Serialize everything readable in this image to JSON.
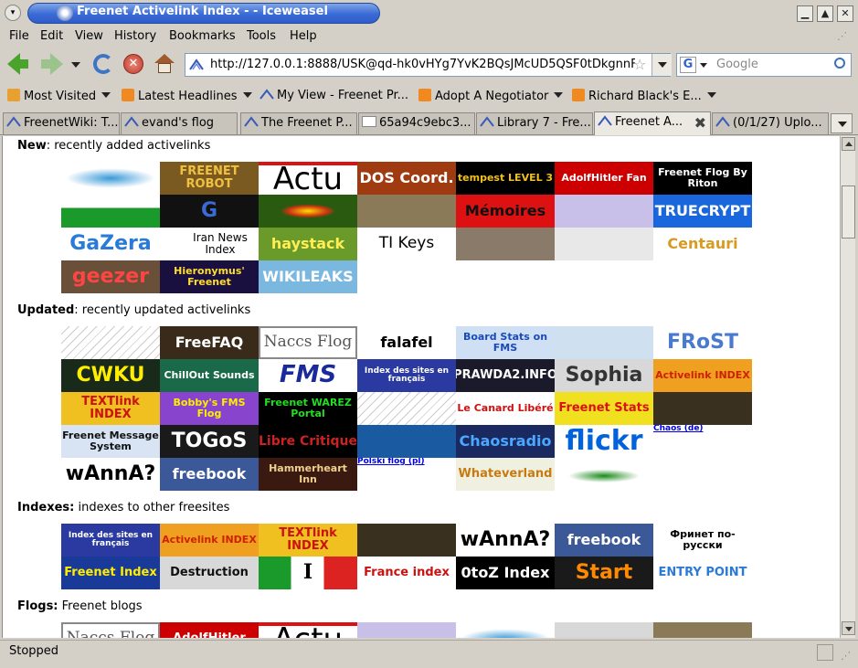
{
  "window": {
    "title": "Freenet Activelink Index - - Iceweasel",
    "buttons": [
      "minimize",
      "maximize",
      "close"
    ]
  },
  "menu": [
    "File",
    "Edit",
    "View",
    "History",
    "Bookmarks",
    "Tools",
    "Help"
  ],
  "nav": {
    "url": "http://127.0.0.1:8888/USK@qd-hk0vHYg7YvK2BQsJMcUD5QSF0tDkgnnF",
    "search_placeholder": "Google",
    "search_engine_letter": "G"
  },
  "bookmarks": [
    {
      "label": "Most Visited",
      "icon": "folder-icon",
      "dropdown": true
    },
    {
      "label": "Latest Headlines",
      "icon": "rss-icon",
      "dropdown": true
    },
    {
      "label": "My View - Freenet Pr...",
      "icon": "freenet-icon",
      "dropdown": false
    },
    {
      "label": "Adopt A Negotiator",
      "icon": "rss-icon",
      "dropdown": true
    },
    {
      "label": "Richard Black's E...",
      "icon": "rss-icon",
      "dropdown": true
    }
  ],
  "tabs": [
    {
      "label": "FreenetWiki: T...",
      "active": false
    },
    {
      "label": "evand's flog",
      "active": false
    },
    {
      "label": "The Freenet P...",
      "active": false
    },
    {
      "label": "65a94c9ebc3...",
      "active": false
    },
    {
      "label": "Library 7 - Fre...",
      "active": false
    },
    {
      "label": "Freenet A...",
      "active": true
    },
    {
      "label": "(0/1/27) Uplo...",
      "active": false
    }
  ],
  "sections": [
    {
      "heading": "New",
      "description": ": recently added activelinks",
      "tiles": [
        {
          "text": "",
          "bg": "#ffffff",
          "fg": "#2a8ac8",
          "kind": "blue-sneaker"
        },
        {
          "text": "FREENET ROBOT",
          "bg": "#7a5a20",
          "fg": "#f0c040"
        },
        {
          "text": "Actu",
          "bg": "#ffffff",
          "fg": "#000000",
          "kind": "actu"
        },
        {
          "text": "DOS Coord.",
          "bg": "#a03a10",
          "fg": "#ffffff"
        },
        {
          "text": "tempest LEVEL 3",
          "bg": "#000000",
          "fg": "#f0c020"
        },
        {
          "text": "AdolfHitler Fan",
          "bg": "#cc0000",
          "fg": "#ffffff"
        },
        {
          "text": "Freenet Flog By Riton",
          "bg": "#000000",
          "fg": "#ffffff"
        },
        {
          "text": "",
          "bg": "#1a9a2a",
          "fg": "#ffffff",
          "kind": "green-flag"
        },
        {
          "text": "G",
          "bg": "#111111",
          "fg": "#3a6ad6"
        },
        {
          "text": "",
          "bg": "#2a5a10",
          "fg": "#ffdd00",
          "kind": "eye"
        },
        {
          "text": "",
          "bg": "#8a7a58",
          "fg": "#ffffff"
        },
        {
          "text": "Mémoires",
          "bg": "#dd1111",
          "fg": "#111111"
        },
        {
          "text": "",
          "bg": "#c8c0e8",
          "fg": "#ffffff"
        },
        {
          "text": "TRUECRYPT",
          "bg": "#1a66dd",
          "fg": "#ffffff"
        },
        {
          "text": "GaZera",
          "bg": "#ffffff",
          "fg": "#2a7ad8"
        },
        {
          "text": "Iran News Index",
          "bg": "#ffffff",
          "fg": "#000000",
          "kind": "iran"
        },
        {
          "text": "haystack",
          "bg": "#6a9a2a",
          "fg": "#ffee55"
        },
        {
          "text": "TI Keys",
          "bg": "#ffffff",
          "fg": "#000000",
          "kind": "tikeys"
        },
        {
          "text": "",
          "bg": "#8a7a6a",
          "fg": "#ffffff"
        },
        {
          "text": "",
          "bg": "#e8e8e8",
          "fg": "#333333"
        },
        {
          "text": "Centauri",
          "bg": "#ffffff",
          "fg": "#d89a20"
        },
        {
          "text": "geezer",
          "bg": "#6a5038",
          "fg": "#ff4444"
        },
        {
          "text": "Hieronymus' Freenet",
          "bg": "#1a1040",
          "fg": "#ffdd33"
        },
        {
          "text": "WIKILEAKS",
          "bg": "#7ab8e0",
          "fg": "#ffffff"
        }
      ]
    },
    {
      "heading": "Updated",
      "description": ": recently updated activelinks",
      "tiles": [
        {
          "text": "",
          "bg": "#f0f0f0",
          "fg": "#000000",
          "kind": "manga"
        },
        {
          "text": "FreeFAQ",
          "bg": "#3a2a1a",
          "fg": "#ffffff"
        },
        {
          "text": "Naccs Flog",
          "bg": "#ffffff",
          "fg": "#555555",
          "kind": "naccs"
        },
        {
          "text": "falafel",
          "bg": "#ffffff",
          "fg": "#000000"
        },
        {
          "text": "Board Stats on FMS",
          "bg": "#d0e0f4",
          "fg": "#1a4ab8"
        },
        {
          "text": "",
          "bg": "#cfe0f0",
          "fg": "#ffffff"
        },
        {
          "text": "FRoST",
          "bg": "#ffffff",
          "fg": "#4a7ad0"
        },
        {
          "text": "CWKU",
          "bg": "#1a2a1a",
          "fg": "#ffee00"
        },
        {
          "text": "ChillOut Sounds",
          "bg": "#1a6a4a",
          "fg": "#ffffff"
        },
        {
          "text": "FMS",
          "bg": "#ffffff",
          "fg": "#1a2a9a",
          "kind": "fms"
        },
        {
          "text": "Index des sites en français",
          "bg": "#2a3aa0",
          "fg": "#ffffff"
        },
        {
          "text": "PRAWDA2.INFO",
          "bg": "#1a1a2a",
          "fg": "#ffffff"
        },
        {
          "text": "Sophia",
          "bg": "#d8d8d8",
          "fg": "#333333"
        },
        {
          "text": "Activelink INDEX",
          "bg": "#f0a020",
          "fg": "#cc2200"
        },
        {
          "text": "TEXTlink INDEX",
          "bg": "#f0c020",
          "fg": "#cc1111"
        },
        {
          "text": "Bobby's FMS Flog",
          "bg": "#8844cc",
          "fg": "#ffee00"
        },
        {
          "text": "Freenet WAREZ Portal",
          "bg": "#000000",
          "fg": "#22dd22"
        },
        {
          "text": "",
          "bg": "#ffffff",
          "fg": "#000000",
          "kind": "manga2"
        },
        {
          "text": "Le Canard Libéré",
          "bg": "#ffffff",
          "fg": "#cc1111"
        },
        {
          "text": "Freenet Stats",
          "bg": "#f0e020",
          "fg": "#dd1111"
        },
        {
          "text": "",
          "bg": "#3a3020",
          "fg": "#ffffff"
        },
        {
          "text": "Freenet Message System",
          "bg": "#d8e4f4",
          "fg": "#111111"
        },
        {
          "text": "TOGoS",
          "bg": "#1a1a1a",
          "fg": "#ffffff"
        },
        {
          "text": "Libre Critique",
          "bg": "#000000",
          "fg": "#cc2222",
          "kind": "libre"
        },
        {
          "text": "",
          "bg": "#1a5aa0",
          "fg": "#ffffff"
        },
        {
          "text": "Chaosradio",
          "bg": "#1a2a60",
          "fg": "#4aa8ff"
        },
        {
          "text": "flickr",
          "bg": "#ffffff",
          "fg": "#0063dc",
          "kind": "flickr"
        },
        {
          "text": "Chaos (de)",
          "bg": "#ffffff",
          "fg": "#0000ee",
          "kind": "linktext"
        },
        {
          "text": "wAnnA?",
          "bg": "#ffffff",
          "fg": "#000000"
        },
        {
          "text": "freebook",
          "bg": "#3b5998",
          "fg": "#ffffff"
        },
        {
          "text": "Hammerheart Inn",
          "bg": "#3a1a10",
          "fg": "#f0d090"
        },
        {
          "text": "Polski flog (pl)",
          "bg": "#ffffff",
          "fg": "#0000ee",
          "kind": "linktext"
        },
        {
          "text": "Whateverland",
          "bg": "#f0f0e0",
          "fg": "#c87a10"
        },
        {
          "text": "",
          "bg": "#ffffff",
          "fg": "#1a8a1a",
          "kind": "frog"
        },
        {
          "text": "",
          "bg": "#ffffff",
          "fg": "#ffffff",
          "kind": "empty"
        }
      ]
    },
    {
      "heading": "Indexes:",
      "description": " indexes to other freesites",
      "tiles": [
        {
          "text": "Index des sites en français",
          "bg": "#2a3aa0",
          "fg": "#ffffff"
        },
        {
          "text": "Activelink INDEX",
          "bg": "#f0a020",
          "fg": "#cc2200"
        },
        {
          "text": "TEXTlink INDEX",
          "bg": "#f0c020",
          "fg": "#cc1111"
        },
        {
          "text": "",
          "bg": "#3a3020",
          "fg": "#ffffff"
        },
        {
          "text": "wAnnA?",
          "bg": "#ffffff",
          "fg": "#000000"
        },
        {
          "text": "freebook",
          "bg": "#3b5998",
          "fg": "#ffffff"
        },
        {
          "text": "Фринет по-русски",
          "bg": "#ffffff",
          "fg": "#000000"
        },
        {
          "text": "Freenet Index",
          "bg": "#1a3a9a",
          "fg": "#ffee00"
        },
        {
          "text": "Destruction",
          "bg": "#d8d8d8",
          "fg": "#111111"
        },
        {
          "text": "I",
          "bg": "#ffffff",
          "fg": "#000000",
          "kind": "italy"
        },
        {
          "text": "France index",
          "bg": "#ffffff",
          "fg": "#cc1111"
        },
        {
          "text": "0toZ Index",
          "bg": "#000000",
          "fg": "#ffffff"
        },
        {
          "text": "Start",
          "bg": "#1a1a1a",
          "fg": "#ff8a00"
        },
        {
          "text": "ENTRY POINT",
          "bg": "#ffffff",
          "fg": "#2a7ad8"
        }
      ]
    },
    {
      "heading": "Flogs:",
      "description": " Freenet blogs",
      "tiles": [
        {
          "text": "Naccs Flog",
          "bg": "#ffffff",
          "fg": "#555555",
          "kind": "naccs"
        },
        {
          "text": "AdolfHitler",
          "bg": "#cc0000",
          "fg": "#ffffff"
        },
        {
          "text": "Actu",
          "bg": "#ffffff",
          "fg": "#000000",
          "kind": "actu"
        },
        {
          "text": "",
          "bg": "#c8c0e8",
          "fg": "#ffffff"
        },
        {
          "text": "",
          "bg": "#ffffff",
          "fg": "#2a8ac8",
          "kind": "blue-sneaker"
        },
        {
          "text": "",
          "bg": "#d8d8d8",
          "fg": "#333333"
        },
        {
          "text": "",
          "bg": "#8a7a58",
          "fg": "#ffffff"
        }
      ]
    }
  ],
  "status": "Stopped"
}
